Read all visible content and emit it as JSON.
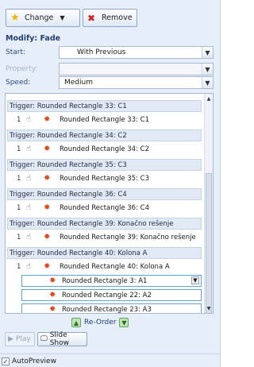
{
  "toolbar": {
    "change_label": "Change",
    "remove_label": "Remove"
  },
  "section_title": "Modify: Fade",
  "fields": {
    "start": {
      "label": "Start:",
      "value": "With Previous"
    },
    "property": {
      "label": "Property:",
      "value": ""
    },
    "speed": {
      "label": "Speed:",
      "value": "Medium"
    }
  },
  "list": [
    {
      "trigger": "Trigger: Rounded Rectangle 33: C1",
      "item_num": "1",
      "item_name": "Rounded Rectangle 33: C1"
    },
    {
      "trigger": "Trigger: Rounded Rectangle 34: C2",
      "item_num": "1",
      "item_name": "Rounded Rectangle 34: C2"
    },
    {
      "trigger": "Trigger: Rounded Rectangle 35: C3",
      "item_num": "1",
      "item_name": "Rounded Rectangle 35: C3"
    },
    {
      "trigger": "Trigger: Rounded Rectangle 36: C4",
      "item_num": "1",
      "item_name": "Rounded Rectangle 36: C4"
    },
    {
      "trigger": "Trigger: Rounded Rectangle 39: Konačno rešenje",
      "item_num": "1",
      "item_name": "Rounded Rectangle 39: Konačno rešenje"
    },
    {
      "trigger": "Trigger: Rounded Rectangle 40: Kolona A",
      "item_num": "1",
      "item_name": "Rounded Rectangle 40: Kolona A"
    }
  ],
  "sub_items": [
    "Rounded Rectangle 3: A1",
    "Rounded Rectangle 22: A2",
    "Rounded Rectangle 23: A3"
  ],
  "reorder_label": "Re-Order",
  "play_label": "Play",
  "slideshow_label": "Slide Show",
  "autopreview_label": "AutoPreview"
}
